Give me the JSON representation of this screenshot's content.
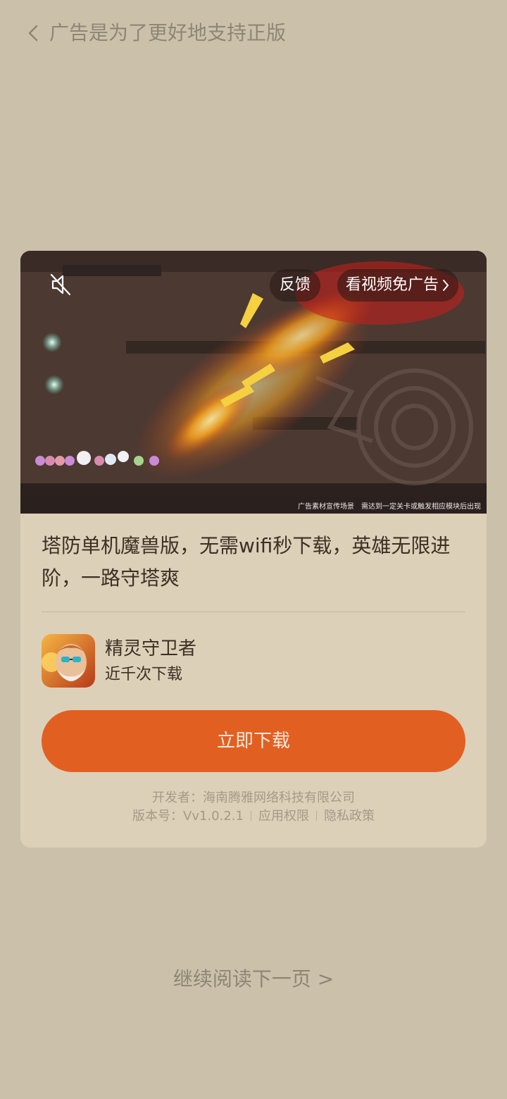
{
  "header": {
    "back_icon": "chevron-left-icon",
    "title": "广告是为了更好地支持正版"
  },
  "ad": {
    "mute_icon": "mute-icon",
    "feedback_label": "反馈",
    "skip_ad_label": "看视频免广告",
    "media_caption": "广告素材宣传场景　需达到一定关卡或触发相应模块后出现",
    "headline": "塔防单机魔兽版，无需wifi秒下载，英雄无限进阶，一路守塔爽",
    "app_name": "精灵守卫者",
    "download_count": "近千次下载",
    "download_button": "立即下载",
    "developer_label": "开发者：",
    "developer": "海南腾雅网络科技有限公司",
    "version_label": "版本号：",
    "version": "Vv1.0.2.1",
    "permissions_link": "应用权限",
    "privacy_link": "隐私政策"
  },
  "footer": {
    "next_page": "继续阅读下一页 >"
  },
  "colors": {
    "background": "#cbc1ab",
    "card": "#dcd0b9",
    "accent": "#e25f22",
    "text_dark": "#3e2f24",
    "text_muted": "#8e8574"
  }
}
